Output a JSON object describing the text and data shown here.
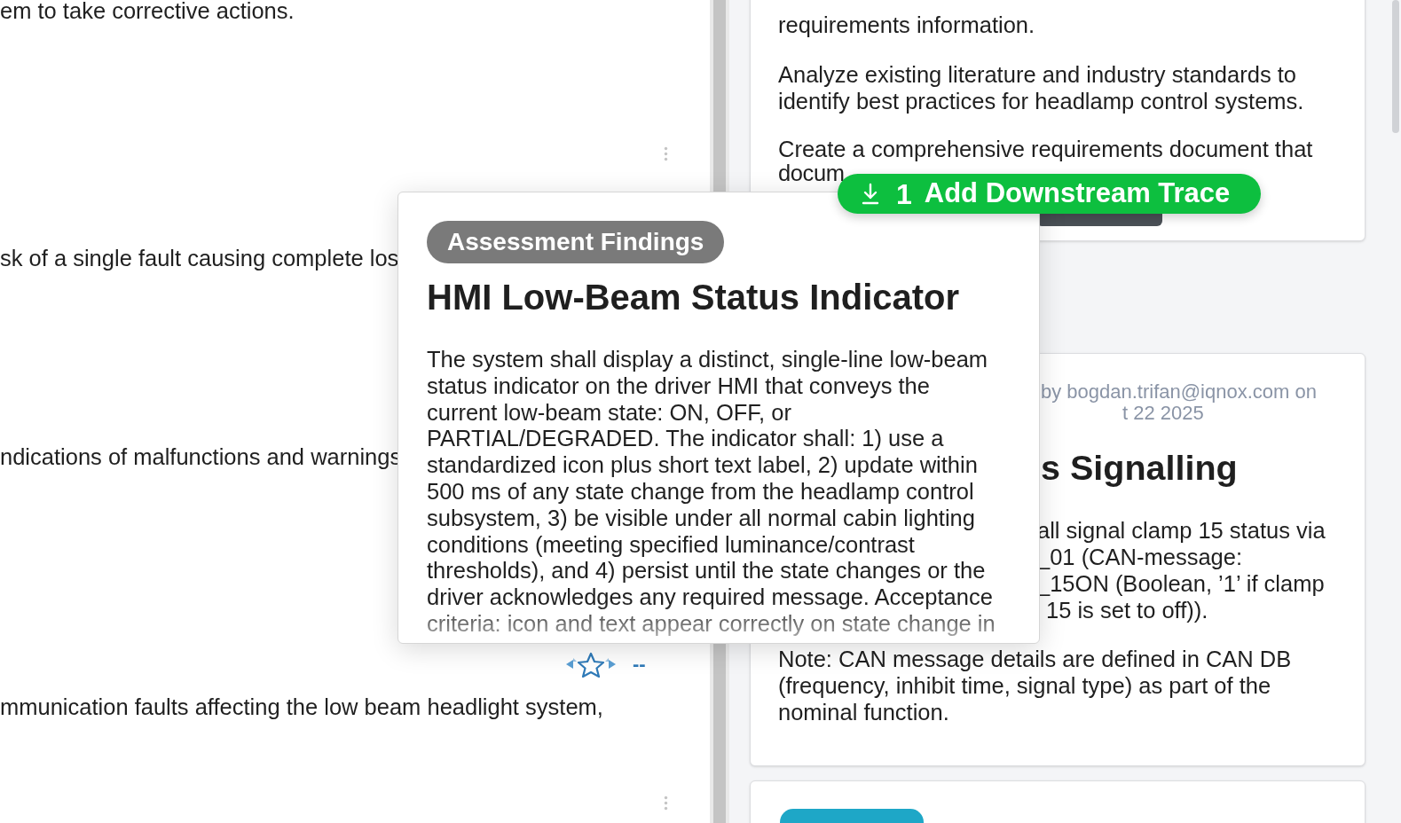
{
  "left_panel": {
    "rows": [
      {
        "text": "em to take corrective actions."
      },
      {
        "text": "sk of a single fault causing complete los"
      },
      {
        "text": "ndications of malfunctions and warnings"
      },
      {
        "text": "mmunication faults affecting the low beam headlight system,"
      }
    ]
  },
  "trace_marker": {
    "value": "--"
  },
  "upper_card": {
    "paragraphs": [
      "requirements information.",
      "Analyze existing literature and industry standards to identify best practices for headlamp control systems.",
      "Create a comprehensive requirements document that",
      "docum"
    ]
  },
  "middle_card": {
    "meta_lines": [
      "by bogdan.trifan@iqnox.com on",
      "t 22 2025"
    ],
    "title": "s Signalling",
    "body_lines": [
      "all signal clamp 15 status via",
      "_01 (CAN-message:",
      "_15ON (Boolean, ’1’ if clamp",
      "15 is set to off))."
    ],
    "note": "Note: CAN message details are defined in CAN DB (frequency, inhibit time, signal type) as part of the nominal function."
  },
  "popup": {
    "badge": "Assessment Findings",
    "title": "HMI Low-Beam Status Indicator",
    "description": "The system shall display a distinct, single-line low-beam status indicator on the driver HMI that conveys the current low-beam state: ON, OFF, or PARTIAL/DEGRADED. The indicator shall: 1) use a standardized icon plus short text label, 2) update within 500 ms of any state change from the headlamp control subsystem, 3) be visible under all normal cabin lighting conditions (meeting specified luminance/contrast thresholds), and 4) persist until the state changes or the driver acknowledges any required message. Acceptance criteria: icon and text appear correctly on state change in"
  },
  "trace_button": {
    "count": "1",
    "label": "Add Downstream Trace"
  }
}
